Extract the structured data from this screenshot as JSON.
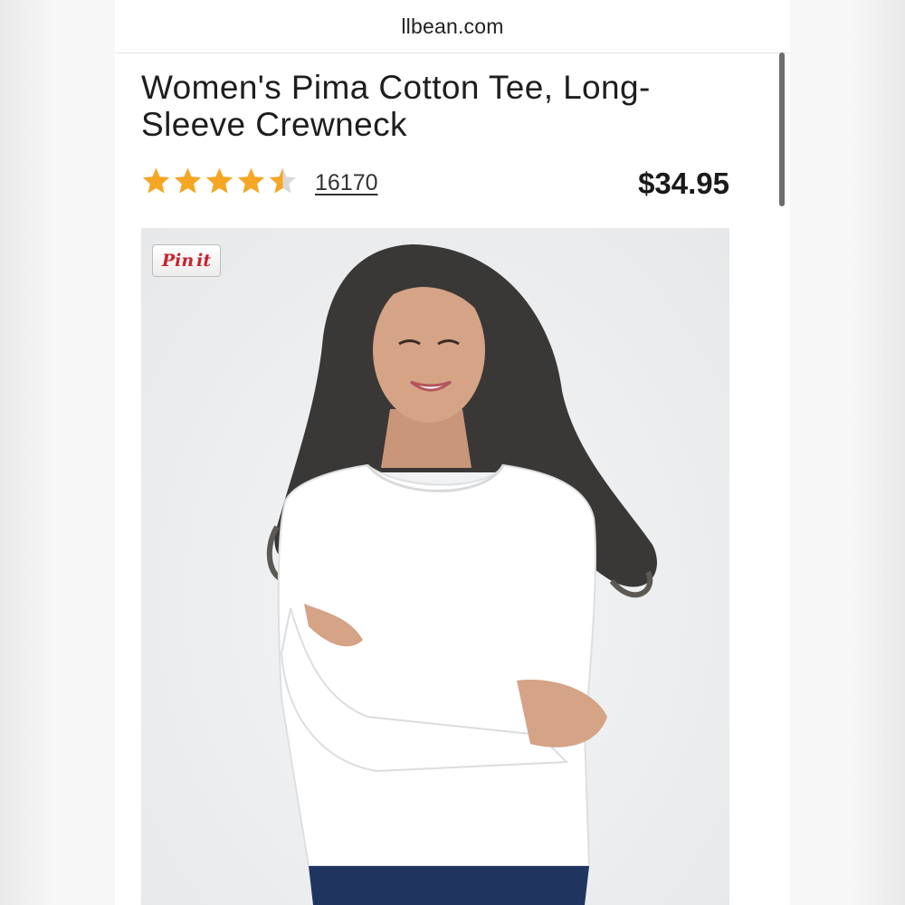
{
  "browser": {
    "url": "llbean.com"
  },
  "product": {
    "title": "Women's Pima Cotton Tee, Long-Sleeve Crewneck",
    "rating": 4.5,
    "rating_max": 5,
    "review_count": "16170",
    "price": "$34.95"
  },
  "image": {
    "pin_label": "Pinit",
    "alt": "Woman wearing a white long-sleeve crewneck tee with arms crossed"
  },
  "colors": {
    "star": "#f5a623",
    "star_empty": "#d9d9d9",
    "pin_red": "#c8232c"
  },
  "icons": {
    "star": "star-icon"
  }
}
